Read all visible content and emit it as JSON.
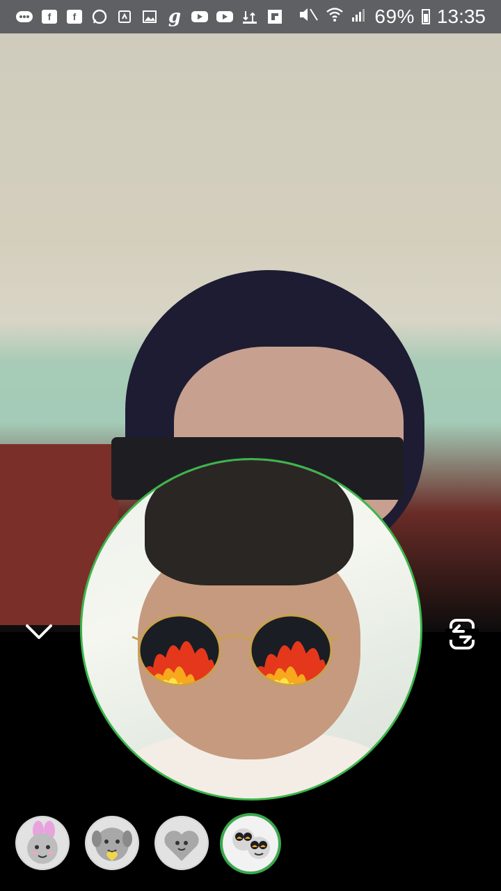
{
  "status_bar": {
    "battery_percent": "69%",
    "time": "13:35",
    "notification_icons": [
      "messages-icon",
      "facebook-icon",
      "facebook-icon",
      "whatsapp-icon",
      "recent-apps-icon",
      "gallery-icon",
      "g-app-icon",
      "youtube-icon",
      "youtube-icon",
      "data-transfer-icon",
      "flipboard-icon",
      "mute-icon",
      "wifi-icon",
      "signal-icon"
    ]
  },
  "controls": {
    "collapse_icon": "chevron-down-icon",
    "flip_camera_icon": "flip-camera-icon"
  },
  "filters": {
    "items": [
      {
        "name": "bunny-ears-filter"
      },
      {
        "name": "heart-dog-filter"
      },
      {
        "name": "grey-heart-filter"
      },
      {
        "name": "fire-glasses-filter",
        "selected": true
      }
    ]
  },
  "colors": {
    "status_bar": "#5f6063",
    "selected_ring": "#3aa84b",
    "selfie_border": "#3bb54a"
  }
}
